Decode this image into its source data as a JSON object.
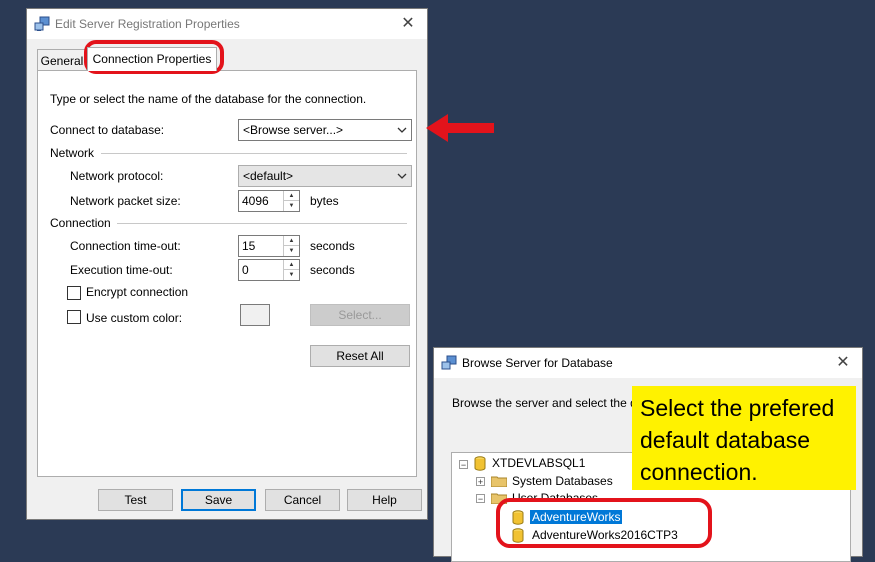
{
  "dialog1": {
    "title": "Edit Server Registration Properties",
    "tabs": [
      "General",
      "Connection Properties"
    ],
    "instruction": "Type or select the name of the database for the connection.",
    "connect_db_label": "Connect to database:",
    "connect_db_value": "<Browse server...>",
    "network_group": "Network",
    "protocol_label": "Network protocol:",
    "protocol_value": "<default>",
    "packet_label": "Network packet size:",
    "packet_value": "4096",
    "packet_unit": "bytes",
    "connection_group": "Connection",
    "timeout_label": "Connection time-out:",
    "timeout_value": "15",
    "timeout_unit": "seconds",
    "exec_label": "Execution time-out:",
    "exec_value": "0",
    "exec_unit": "seconds",
    "encrypt_label": "Encrypt connection",
    "custom_color_label": "Use custom color:",
    "select_button": "Select...",
    "reset_button": "Reset All",
    "footer": {
      "test": "Test",
      "save": "Save",
      "cancel": "Cancel",
      "help": "Help"
    }
  },
  "dialog2": {
    "title": "Browse Server for Database",
    "instruction": "Browse the server and select the da",
    "tree": {
      "server": "XTDEVLABSQL1",
      "system_db": "System Databases",
      "user_db": "User Databases",
      "items": [
        "AdventureWorks",
        "AdventureWorks2016CTP3"
      ]
    }
  },
  "callout": {
    "line1": "Select the prefered",
    "line2": "default database",
    "line3": "connection."
  },
  "colors": {
    "highlight": "#e3131b",
    "callout_bg": "#fff200",
    "selection": "#0078d7",
    "desktop": "#2b3a55"
  }
}
